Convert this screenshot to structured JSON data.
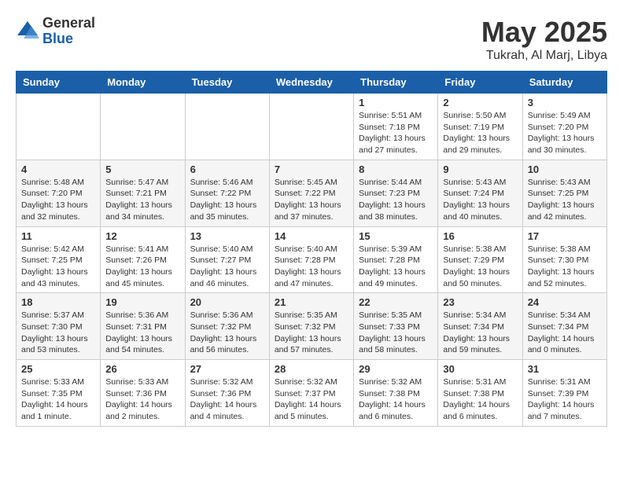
{
  "logo": {
    "general": "General",
    "blue": "Blue"
  },
  "title": {
    "month": "May 2025",
    "location": "Tukrah, Al Marj, Libya"
  },
  "weekdays": [
    "Sunday",
    "Monday",
    "Tuesday",
    "Wednesday",
    "Thursday",
    "Friday",
    "Saturday"
  ],
  "weeks": [
    [
      {
        "day": "",
        "info": ""
      },
      {
        "day": "",
        "info": ""
      },
      {
        "day": "",
        "info": ""
      },
      {
        "day": "",
        "info": ""
      },
      {
        "day": "1",
        "info": "Sunrise: 5:51 AM\nSunset: 7:18 PM\nDaylight: 13 hours and 27 minutes."
      },
      {
        "day": "2",
        "info": "Sunrise: 5:50 AM\nSunset: 7:19 PM\nDaylight: 13 hours and 29 minutes."
      },
      {
        "day": "3",
        "info": "Sunrise: 5:49 AM\nSunset: 7:20 PM\nDaylight: 13 hours and 30 minutes."
      }
    ],
    [
      {
        "day": "4",
        "info": "Sunrise: 5:48 AM\nSunset: 7:20 PM\nDaylight: 13 hours and 32 minutes."
      },
      {
        "day": "5",
        "info": "Sunrise: 5:47 AM\nSunset: 7:21 PM\nDaylight: 13 hours and 34 minutes."
      },
      {
        "day": "6",
        "info": "Sunrise: 5:46 AM\nSunset: 7:22 PM\nDaylight: 13 hours and 35 minutes."
      },
      {
        "day": "7",
        "info": "Sunrise: 5:45 AM\nSunset: 7:22 PM\nDaylight: 13 hours and 37 minutes."
      },
      {
        "day": "8",
        "info": "Sunrise: 5:44 AM\nSunset: 7:23 PM\nDaylight: 13 hours and 38 minutes."
      },
      {
        "day": "9",
        "info": "Sunrise: 5:43 AM\nSunset: 7:24 PM\nDaylight: 13 hours and 40 minutes."
      },
      {
        "day": "10",
        "info": "Sunrise: 5:43 AM\nSunset: 7:25 PM\nDaylight: 13 hours and 42 minutes."
      }
    ],
    [
      {
        "day": "11",
        "info": "Sunrise: 5:42 AM\nSunset: 7:25 PM\nDaylight: 13 hours and 43 minutes."
      },
      {
        "day": "12",
        "info": "Sunrise: 5:41 AM\nSunset: 7:26 PM\nDaylight: 13 hours and 45 minutes."
      },
      {
        "day": "13",
        "info": "Sunrise: 5:40 AM\nSunset: 7:27 PM\nDaylight: 13 hours and 46 minutes."
      },
      {
        "day": "14",
        "info": "Sunrise: 5:40 AM\nSunset: 7:28 PM\nDaylight: 13 hours and 47 minutes."
      },
      {
        "day": "15",
        "info": "Sunrise: 5:39 AM\nSunset: 7:28 PM\nDaylight: 13 hours and 49 minutes."
      },
      {
        "day": "16",
        "info": "Sunrise: 5:38 AM\nSunset: 7:29 PM\nDaylight: 13 hours and 50 minutes."
      },
      {
        "day": "17",
        "info": "Sunrise: 5:38 AM\nSunset: 7:30 PM\nDaylight: 13 hours and 52 minutes."
      }
    ],
    [
      {
        "day": "18",
        "info": "Sunrise: 5:37 AM\nSunset: 7:30 PM\nDaylight: 13 hours and 53 minutes."
      },
      {
        "day": "19",
        "info": "Sunrise: 5:36 AM\nSunset: 7:31 PM\nDaylight: 13 hours and 54 minutes."
      },
      {
        "day": "20",
        "info": "Sunrise: 5:36 AM\nSunset: 7:32 PM\nDaylight: 13 hours and 56 minutes."
      },
      {
        "day": "21",
        "info": "Sunrise: 5:35 AM\nSunset: 7:32 PM\nDaylight: 13 hours and 57 minutes."
      },
      {
        "day": "22",
        "info": "Sunrise: 5:35 AM\nSunset: 7:33 PM\nDaylight: 13 hours and 58 minutes."
      },
      {
        "day": "23",
        "info": "Sunrise: 5:34 AM\nSunset: 7:34 PM\nDaylight: 13 hours and 59 minutes."
      },
      {
        "day": "24",
        "info": "Sunrise: 5:34 AM\nSunset: 7:34 PM\nDaylight: 14 hours and 0 minutes."
      }
    ],
    [
      {
        "day": "25",
        "info": "Sunrise: 5:33 AM\nSunset: 7:35 PM\nDaylight: 14 hours and 1 minute."
      },
      {
        "day": "26",
        "info": "Sunrise: 5:33 AM\nSunset: 7:36 PM\nDaylight: 14 hours and 2 minutes."
      },
      {
        "day": "27",
        "info": "Sunrise: 5:32 AM\nSunset: 7:36 PM\nDaylight: 14 hours and 4 minutes."
      },
      {
        "day": "28",
        "info": "Sunrise: 5:32 AM\nSunset: 7:37 PM\nDaylight: 14 hours and 5 minutes."
      },
      {
        "day": "29",
        "info": "Sunrise: 5:32 AM\nSunset: 7:38 PM\nDaylight: 14 hours and 6 minutes."
      },
      {
        "day": "30",
        "info": "Sunrise: 5:31 AM\nSunset: 7:38 PM\nDaylight: 14 hours and 6 minutes."
      },
      {
        "day": "31",
        "info": "Sunrise: 5:31 AM\nSunset: 7:39 PM\nDaylight: 14 hours and 7 minutes."
      }
    ]
  ]
}
